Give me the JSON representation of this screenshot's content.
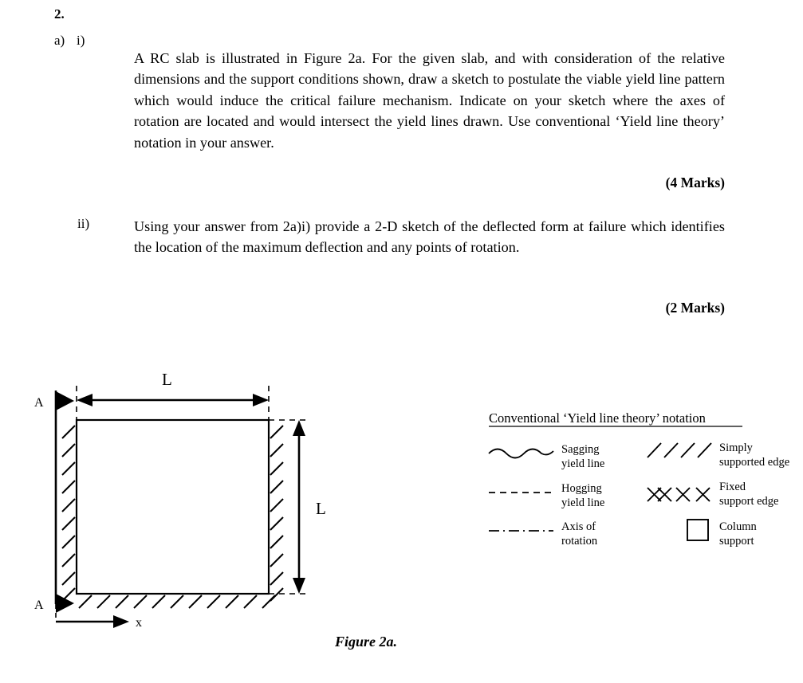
{
  "question": {
    "number": "2.",
    "part_a_label": "a)",
    "sub_i_label": "i)",
    "sub_ii_label": "ii)",
    "paragraph_i": "A RC slab is illustrated in Figure 2a.  For the given slab, and with consideration of the relative dimensions and the support conditions shown, draw a sketch to postulate the viable yield line pattern which would induce the critical failure mechanism.  Indicate on your sketch where the axes of rotation are located and would intersect the yield lines drawn.  Use conventional ‘Yield line theory’ notation in your answer.",
    "marks_i": "(4 Marks)",
    "paragraph_ii": "Using your answer from 2a)i) provide a 2-D sketch of the deflected form at failure which identifies the location of the maximum deflection and any points of rotation.",
    "marks_ii": "(2 Marks)"
  },
  "figure": {
    "caption": "Figure 2a.",
    "width_dimension_label": "L",
    "height_dimension_label": "L",
    "x_axis_label": "x",
    "section_label_top": "A",
    "section_label_bottom": "A"
  },
  "legend": {
    "title": "Conventional ‘Yield line theory’ notation",
    "items": [
      {
        "symbol": "wavy-line-icon",
        "line1": "Sagging",
        "line2": "yield line"
      },
      {
        "symbol": "dashed-line-icon",
        "line1": "Hogging",
        "line2": "yield line"
      },
      {
        "symbol": "dash-dot-line-icon",
        "line1": "Axis of",
        "line2": "rotation"
      },
      {
        "symbol": "slash-hatch-icon",
        "line1": "Simply",
        "line2": "supported edge"
      },
      {
        "symbol": "cross-hatch-icon",
        "line1": "Fixed",
        "line2": "support edge"
      },
      {
        "symbol": "square-icon",
        "line1": "Column",
        "line2": "support"
      }
    ]
  },
  "colors": {
    "ink": "#000000",
    "paper": "#ffffff"
  }
}
